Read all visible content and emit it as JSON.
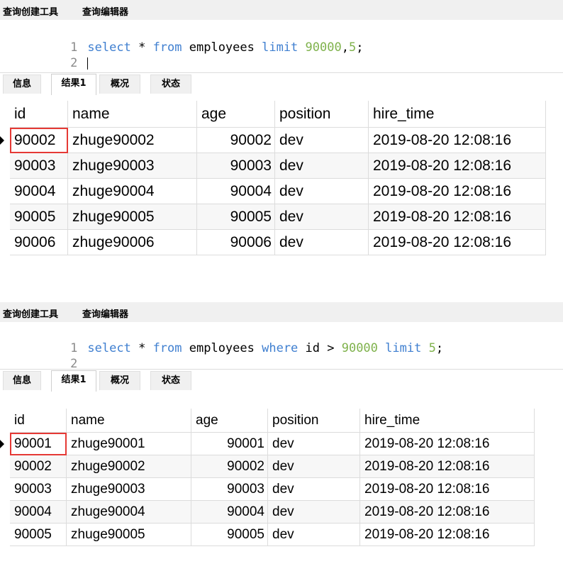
{
  "panels": [
    {
      "tabs": [
        "查询创建工具",
        "查询编辑器"
      ],
      "editor": {
        "lines": [
          {
            "no": "1",
            "tokens": [
              {
                "t": "select",
                "k": "kw"
              },
              {
                "t": " * ",
                "k": "plain"
              },
              {
                "t": "from",
                "k": "kw"
              },
              {
                "t": " employees ",
                "k": "plain"
              },
              {
                "t": "limit",
                "k": "kw"
              },
              {
                "t": " ",
                "k": "plain"
              },
              {
                "t": "90000",
                "k": "num"
              },
              {
                "t": ",",
                "k": "plain"
              },
              {
                "t": "5",
                "k": "num"
              },
              {
                "t": ";",
                "k": "plain"
              }
            ]
          },
          {
            "no": "2",
            "tokens": [],
            "caret": true
          }
        ]
      },
      "result_tabs": [
        "信息",
        "结果1",
        "概况",
        "状态"
      ],
      "active_result_tab": "结果1",
      "columns": [
        "id",
        "name",
        "age",
        "position",
        "hire_time"
      ],
      "rows": [
        [
          "90002",
          "zhuge90002",
          "90002",
          "dev",
          "2019-08-20 12:08:16"
        ],
        [
          "90003",
          "zhuge90003",
          "90003",
          "dev",
          "2019-08-20 12:08:16"
        ],
        [
          "90004",
          "zhuge90004",
          "90004",
          "dev",
          "2019-08-20 12:08:16"
        ],
        [
          "90005",
          "zhuge90005",
          "90005",
          "dev",
          "2019-08-20 12:08:16"
        ],
        [
          "90006",
          "zhuge90006",
          "90006",
          "dev",
          "2019-08-20 12:08:16"
        ]
      ],
      "highlighted_cell": "90002"
    },
    {
      "tabs": [
        "查询创建工具",
        "查询编辑器"
      ],
      "editor": {
        "lines": [
          {
            "no": "1",
            "tokens": [
              {
                "t": "select",
                "k": "kw"
              },
              {
                "t": " * ",
                "k": "plain"
              },
              {
                "t": "from",
                "k": "kw"
              },
              {
                "t": " employees ",
                "k": "plain"
              },
              {
                "t": "where",
                "k": "kw"
              },
              {
                "t": " id > ",
                "k": "plain"
              },
              {
                "t": "90000",
                "k": "num"
              },
              {
                "t": " ",
                "k": "plain"
              },
              {
                "t": "limit",
                "k": "kw"
              },
              {
                "t": " ",
                "k": "plain"
              },
              {
                "t": "5",
                "k": "num"
              },
              {
                "t": ";",
                "k": "plain"
              }
            ]
          },
          {
            "no": "2",
            "tokens": []
          }
        ]
      },
      "result_tabs": [
        "信息",
        "结果1",
        "概况",
        "状态"
      ],
      "active_result_tab": "结果1",
      "columns": [
        "id",
        "name",
        "age",
        "position",
        "hire_time"
      ],
      "rows": [
        [
          "90001",
          "zhuge90001",
          "90001",
          "dev",
          "2019-08-20 12:08:16"
        ],
        [
          "90002",
          "zhuge90002",
          "90002",
          "dev",
          "2019-08-20 12:08:16"
        ],
        [
          "90003",
          "zhuge90003",
          "90003",
          "dev",
          "2019-08-20 12:08:16"
        ],
        [
          "90004",
          "zhuge90004",
          "90004",
          "dev",
          "2019-08-20 12:08:16"
        ],
        [
          "90005",
          "zhuge90005",
          "90005",
          "dev",
          "2019-08-20 12:08:16"
        ]
      ],
      "highlighted_cell": "90001"
    }
  ],
  "colors": {
    "keyword": "#3f7fd0",
    "number": "#7fb24c",
    "highlight_box": "#e53935",
    "row_alt": "#f7f7f7",
    "tab_bar": "#f0f0f0"
  }
}
